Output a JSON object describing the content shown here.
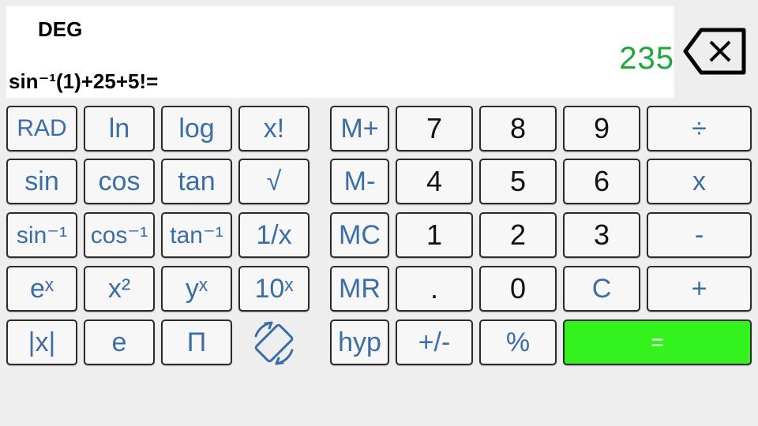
{
  "display": {
    "mode": "DEG",
    "result": "235",
    "expression": "sin⁻¹(1)+25+5!="
  },
  "icons": {
    "backspace": "backspace-icon",
    "rotate": "screen-rotation-icon"
  },
  "colors": {
    "key_text": "#3a6ea5",
    "digit_text": "#111111",
    "result_text": "#1fa83a",
    "equals_bg": "#33f21e"
  },
  "keys": {
    "rad": "RAD",
    "ln": "ln",
    "log": "log",
    "fact": "x!",
    "sin": "sin",
    "cos": "cos",
    "tan": "tan",
    "sqrt": "√",
    "asin": "sin⁻¹",
    "acos": "cos⁻¹",
    "atan": "tan⁻¹",
    "recip": "1/x",
    "exp": "eˣ",
    "square": "x²",
    "power": "yˣ",
    "pow10": "10ˣ",
    "abs": "|x|",
    "e": "e",
    "pi": "Π",
    "mplus": "M+",
    "mminus": "M-",
    "mc": "MC",
    "mr": "MR",
    "hyp": "hyp",
    "d7": "7",
    "d8": "8",
    "d9": "9",
    "div": "÷",
    "d4": "4",
    "d5": "5",
    "d6": "6",
    "mul": "x",
    "d1": "1",
    "d2": "2",
    "d3": "3",
    "sub": "-",
    "dot": ".",
    "d0": "0",
    "clear": "C",
    "add": "+",
    "sign": "+/-",
    "percent": "%",
    "equals": "="
  }
}
